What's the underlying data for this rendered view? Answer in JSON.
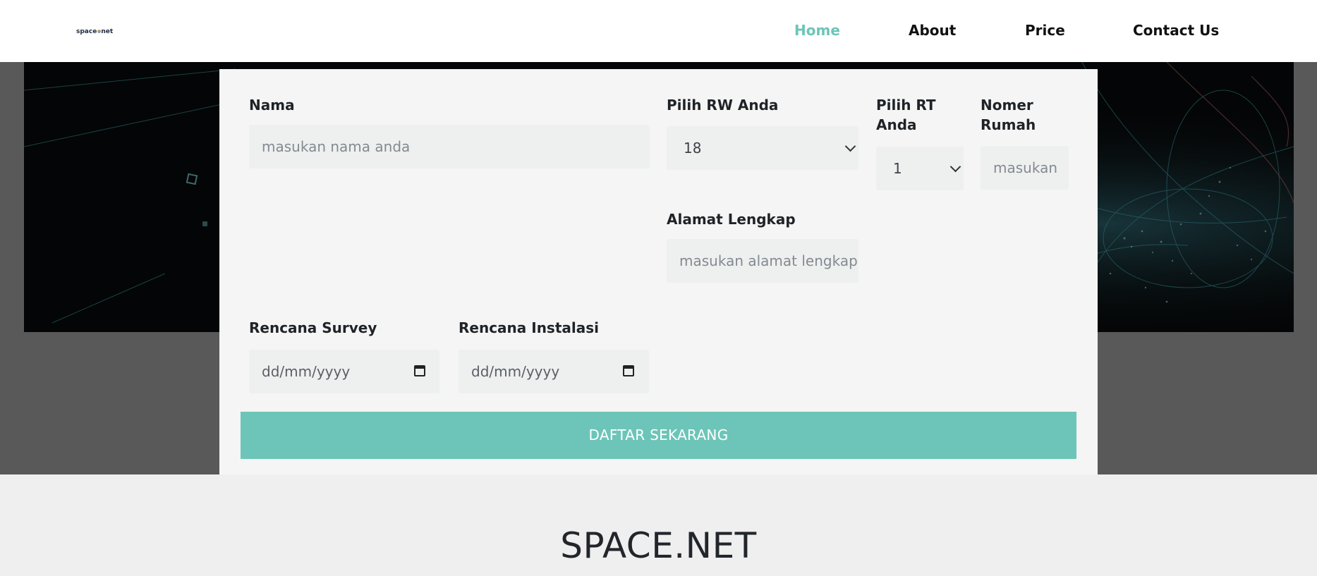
{
  "navbar": {
    "logo_prefix": "space",
    "logo_suffix": "net",
    "links": [
      {
        "label": "Home",
        "active": true
      },
      {
        "label": "About",
        "active": false
      },
      {
        "label": "Price",
        "active": false
      },
      {
        "label": "Contact Us",
        "active": false
      }
    ]
  },
  "form": {
    "nama": {
      "label": "Nama",
      "placeholder": "masukan nama anda"
    },
    "rw": {
      "label": "Pilih RW Anda",
      "value": "18"
    },
    "rt": {
      "label_line1": "Pilih RT",
      "label_line2": "Anda",
      "value": "1"
    },
    "rumah": {
      "label_line1": "Nomer",
      "label_line2": "Rumah",
      "placeholder": "masukan"
    },
    "alamat": {
      "label": "Alamat Lengkap",
      "placeholder": "masukan alamat lengkap"
    },
    "survey": {
      "label": "Rencana Survey",
      "placeholder": "dd/mm/yyyy"
    },
    "instalasi": {
      "label": "Rencana Instalasi",
      "placeholder": "dd/mm/yyyy"
    },
    "submit_label": "DAFTAR SEKARANG"
  },
  "section": {
    "title": "SPACE.NET"
  },
  "colors": {
    "accent": "#6cc5b8",
    "card_bg": "#f4f5f4",
    "input_bg": "#eef0ef",
    "band_bg": "#595959",
    "footer_bg": "#efefef"
  }
}
